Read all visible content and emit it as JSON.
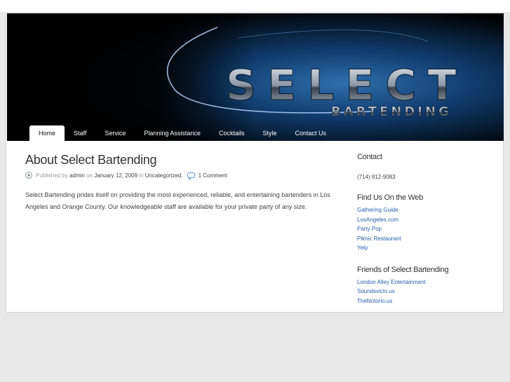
{
  "header": {
    "logo_main": "SELECT",
    "logo_sub": "BARTENDING"
  },
  "nav": {
    "items": [
      {
        "label": "Home",
        "active": true
      },
      {
        "label": "Staff"
      },
      {
        "label": "Service"
      },
      {
        "label": "Planning Assistance"
      },
      {
        "label": "Cocktails"
      },
      {
        "label": "Style"
      },
      {
        "label": "Contact Us"
      }
    ]
  },
  "post": {
    "title": "About Select Bartending",
    "meta_published_by": "Published by",
    "meta_author": "admin",
    "meta_on": "on",
    "meta_date": "January 12, 2009",
    "meta_in": "in",
    "meta_category": "Uncategorized.",
    "meta_comments": "1 Comment",
    "body": "Select Bartending prides itself on providing the most experienced, reliable, and entertaining bartenders in Los Angeles and Orange County.  Our knowledgeable staff are available for your private party of any size."
  },
  "sidebar": {
    "contact_heading": "Contact",
    "contact_phone": "(714) 812-9083",
    "find_heading": "Find Us On the Web",
    "find_links": [
      "Gathering Guide",
      "LosAngeles.com",
      "Party Pop",
      "Piknic Restaurant",
      "Yelp"
    ],
    "friends_heading": "Friends of Select Bartending",
    "friends_links": [
      "London Alley Entertainment",
      "Soundsvicio.us",
      "TheNotorio.us"
    ]
  },
  "colors": {
    "link": "#2a5db0",
    "header_bg": "#000000",
    "page_bg": "#e8e8e8"
  }
}
